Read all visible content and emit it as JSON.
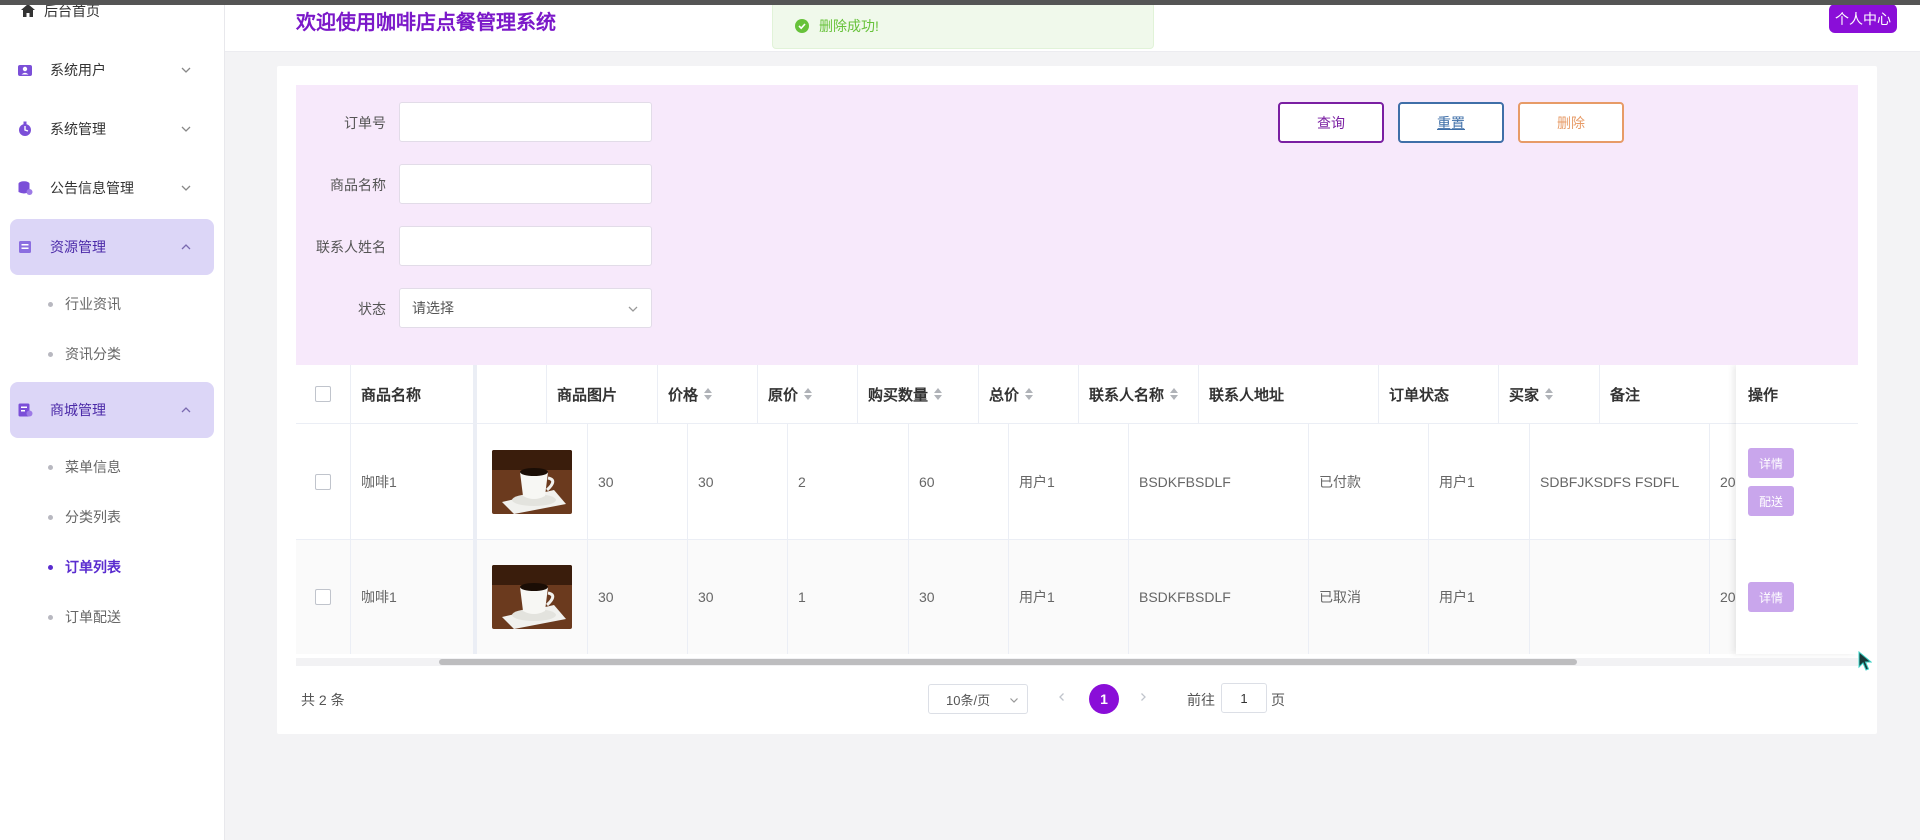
{
  "header": {
    "title": "欢迎使用咖啡店点餐管理系统",
    "user_center": "个人中心"
  },
  "toast": {
    "message": "删除成功!"
  },
  "sidebar": {
    "home": "后台首页",
    "menus": [
      {
        "label": "系统用户",
        "icon": "user-icon",
        "expanded": false
      },
      {
        "label": "系统管理",
        "icon": "settings-icon",
        "expanded": false
      },
      {
        "label": "公告信息管理",
        "icon": "database-icon",
        "expanded": false
      },
      {
        "label": "资源管理",
        "icon": "resource-icon",
        "expanded": true,
        "items": [
          "行业资讯",
          "资讯分类"
        ]
      },
      {
        "label": "商城管理",
        "icon": "shop-icon",
        "expanded": true,
        "items": [
          "菜单信息",
          "分类列表",
          "订单列表",
          "订单配送"
        ]
      }
    ],
    "active_item": "订单列表"
  },
  "search": {
    "fields": [
      {
        "label": "订单号",
        "value": ""
      },
      {
        "label": "商品名称",
        "value": ""
      },
      {
        "label": "联系人姓名",
        "value": ""
      },
      {
        "label": "状态",
        "placeholder": "请选择"
      }
    ],
    "buttons": {
      "query": "查询",
      "reset": "重置",
      "delete": "删除"
    }
  },
  "table": {
    "columns": [
      "商品名称",
      "商品图片",
      "价格",
      "原价",
      "购买数量",
      "总价",
      "联系人名称",
      "联系人地址",
      "订单状态",
      "买家",
      "备注",
      "操作"
    ],
    "rows": [
      {
        "name": "咖啡1",
        "image": "coffee-cup-image",
        "price": "30",
        "orig_price": "30",
        "qty": "2",
        "total": "60",
        "contact": "用户1",
        "address": "BSDKFBSDLF",
        "status": "已付款",
        "buyer": "用户1",
        "remark": "SDBFJKSDFS FSDFL",
        "extra": "20",
        "actions": [
          "详情",
          "配送"
        ]
      },
      {
        "name": "咖啡1",
        "image": "coffee-cup-image",
        "price": "30",
        "orig_price": "30",
        "qty": "1",
        "total": "30",
        "contact": "用户1",
        "address": "BSDKFBSDLF",
        "status": "已取消",
        "buyer": "用户1",
        "remark": "",
        "extra": "20",
        "actions": [
          "详情"
        ]
      }
    ]
  },
  "pagination": {
    "total": "共 2 条",
    "page_size": "10条/页",
    "current": "1",
    "goto_label": "前往",
    "goto_value": "1",
    "goto_suffix": "页"
  },
  "colors": {
    "accent": "#8a0ed8",
    "title": "#7b18c9",
    "panel_bg": "#f7e9fb",
    "active_menu_bg": "#dcd6f7",
    "success": "#67c23a",
    "op_button": "#c9a6ec"
  }
}
